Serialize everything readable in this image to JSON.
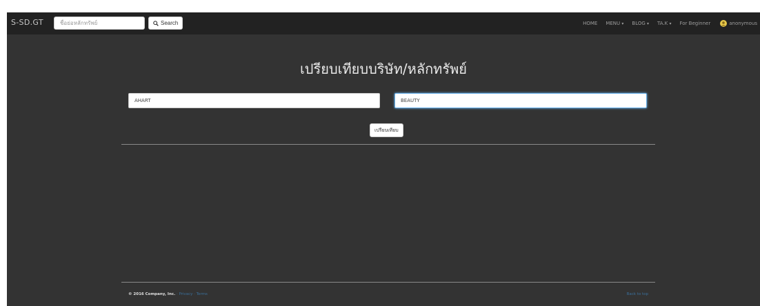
{
  "navbar": {
    "brand": "S-SD.GT",
    "search_placeholder": "ชื่อย่อหลักทรัพย์",
    "search_button": "Search",
    "items": [
      {
        "label": "HOME"
      },
      {
        "label": "MENU"
      },
      {
        "label": "BLOG"
      },
      {
        "label": "TA.K"
      },
      {
        "label": "For Beginner"
      }
    ],
    "user": "anonymous",
    "caret": "▾"
  },
  "main": {
    "title": "เปรียบเทียบบริษัท/หลักทรัพย์",
    "stock1_value": "AHART",
    "stock2_value": "BEAUTY",
    "compare_button": "เปรียบเทียบ"
  },
  "footer": {
    "copyright": "© 2016 Company, Inc.",
    "privacy": "Privacy",
    "separator": " · ",
    "terms": "Terms",
    "back_to_top": "Back to top"
  },
  "colors": {
    "navbar_bg": "#222222",
    "page_bg": "#333333",
    "link": "#3a6f9a",
    "focus": "#66afe9"
  }
}
